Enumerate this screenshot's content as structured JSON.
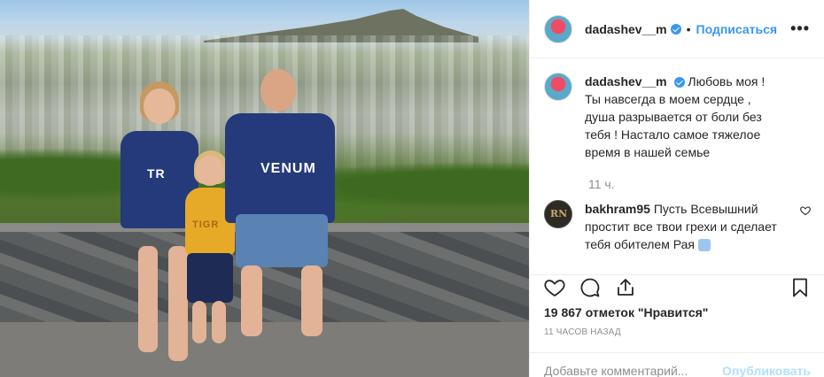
{
  "post": {
    "username": "dadashev__m",
    "dot": "•",
    "follow_label": "Подписаться",
    "more_label": "•••",
    "caption_username": "dadashev__m",
    "caption_text": "Любовь моя ! Ты навсегда в моем сердце , душа разрывается от боли без тебя ! Настало самое тяжелое время в нашей семье",
    "caption_time": "11 ч.",
    "likes_text": "19 867 отметок \"Нравится\"",
    "post_time": "11 ЧАСОВ НАЗАД",
    "comment_placeholder": "Добавьте комментарий...",
    "publish_label": "Опубликовать"
  },
  "comments": [
    {
      "username": "bakhram95",
      "text": "Пусть Всевышний простит все твои грехи и сделает тебя обителем Рая"
    }
  ],
  "photo": {
    "shirt_text_left": "TR",
    "shirt_text_right": "VENUM",
    "shirt_text_child": "TIGR"
  },
  "colors": {
    "accent": "#3897f0",
    "publish_disabled": "#b2dffc",
    "text_muted": "#8e8e8e"
  },
  "icons": [
    "heart-icon",
    "comment-icon",
    "share-icon",
    "bookmark-icon",
    "verified-icon",
    "more-icon"
  ]
}
